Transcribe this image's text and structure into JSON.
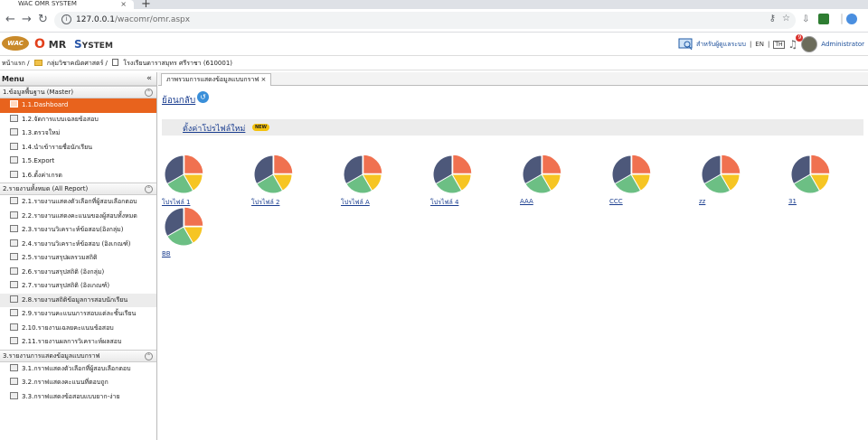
{
  "browser": {
    "tab_title": "WAC OMR SYSTEM",
    "tab_close": "×",
    "new_tab": "+",
    "url_host": "127.0.0.1",
    "url_path": "/wacomr/omr.aspx"
  },
  "header": {
    "logo_text": "WAC",
    "title_o": "O",
    "title_mr": "MR",
    "title_s": "S",
    "title_ystem": "YSTEM",
    "admin_link": "สำหรับผู้ดูแลระบบ",
    "lang_en": "EN",
    "lang_th": "TH",
    "notification_count": "9",
    "username": "Administrator"
  },
  "breadcrumb": {
    "home": "หน้าแรก /",
    "dept": "กลุ่มวิชาคณิตศาสตร์ /",
    "school": "โรงเรียนดาราสมุทร ศรีราชา (610001)"
  },
  "sidebar": {
    "title": "Menu",
    "collapse": "«",
    "groups": [
      {
        "label": "1.ข้อมูลพื้นฐาน (Master)",
        "items": [
          {
            "label": "1.1.Dashboard",
            "active": true
          },
          {
            "label": "1.2.จัดการแบบเฉลยข้อสอบ"
          },
          {
            "label": "1.3.ตรวจใหม่"
          },
          {
            "label": "1.4.นำเข้ารายชื่อนักเรียน"
          },
          {
            "label": "1.5.Export"
          },
          {
            "label": "1.6.ตั้งค่าเกรด"
          }
        ]
      },
      {
        "label": "2.รายงานทั้งหมด (All Report)",
        "items": [
          {
            "label": "2.1.รายงานแสดงตัวเลือกที่ผู้สอบเลือกตอบ"
          },
          {
            "label": "2.2.รายงานแสดงคะแนนของผู้สอบทั้งหมด"
          },
          {
            "label": "2.3.รายงานวิเคราะห์ข้อสอบ(อิงกลุ่ม)"
          },
          {
            "label": "2.4.รายงานวิเคราะห์ข้อสอบ (อิงเกณฑ์)"
          },
          {
            "label": "2.5.รายงานสรุปผลรวมสถิติ"
          },
          {
            "label": "2.6.รายงานสรุปสถิติ (อิงกลุ่ม)"
          },
          {
            "label": "2.7.รายงานสรุปสถิติ (อิงเกณฑ์)"
          },
          {
            "label": "2.8.รายงานสถิติข้อมูลการสอบนักเรียน",
            "highlight": true
          },
          {
            "label": "2.9.รายงานคะแนนการสอบแต่ละชั้นเรียน"
          },
          {
            "label": "2.10.รายงานเฉลยคะแนนข้อสอบ"
          },
          {
            "label": "2.11.รายงานผลการวิเคราะห์ผลสอบ"
          }
        ]
      },
      {
        "label": "3.รายงานการแสดงข้อมูลแบบกราฟ",
        "items": [
          {
            "label": "3.1.กราฟแสดงตัวเลือกที่ผู้สอบเลือกตอบ"
          },
          {
            "label": "3.2.กราฟแสดงคะแนนที่ตอบถูก"
          },
          {
            "label": "3.3.กราฟแสดงข้อสอบแบบยาก-ง่าย"
          }
        ]
      }
    ]
  },
  "main": {
    "tab_label": "ภาพรวมการแสดงข้อมูลแบบกราฟ ×",
    "back_label": "ย้อนกลับ",
    "new_profile_label": "ตั้งค่าโปรไฟล์ใหม่",
    "new_badge": "NEW",
    "profiles": [
      {
        "label": "โปรไฟล์ 1"
      },
      {
        "label": "โปรไฟล์ 2"
      },
      {
        "label": "โปรไฟล์ A"
      },
      {
        "label": "โปรไฟล์ 4"
      },
      {
        "label": "AAA"
      },
      {
        "label": "CCC"
      },
      {
        "label": "zz"
      },
      {
        "label": "31"
      },
      {
        "label": "BB"
      }
    ]
  },
  "colors": {
    "accent": "#e8631d",
    "pie": [
      "#f07150",
      "#f6c523",
      "#6cbf84",
      "#4d587a"
    ]
  }
}
